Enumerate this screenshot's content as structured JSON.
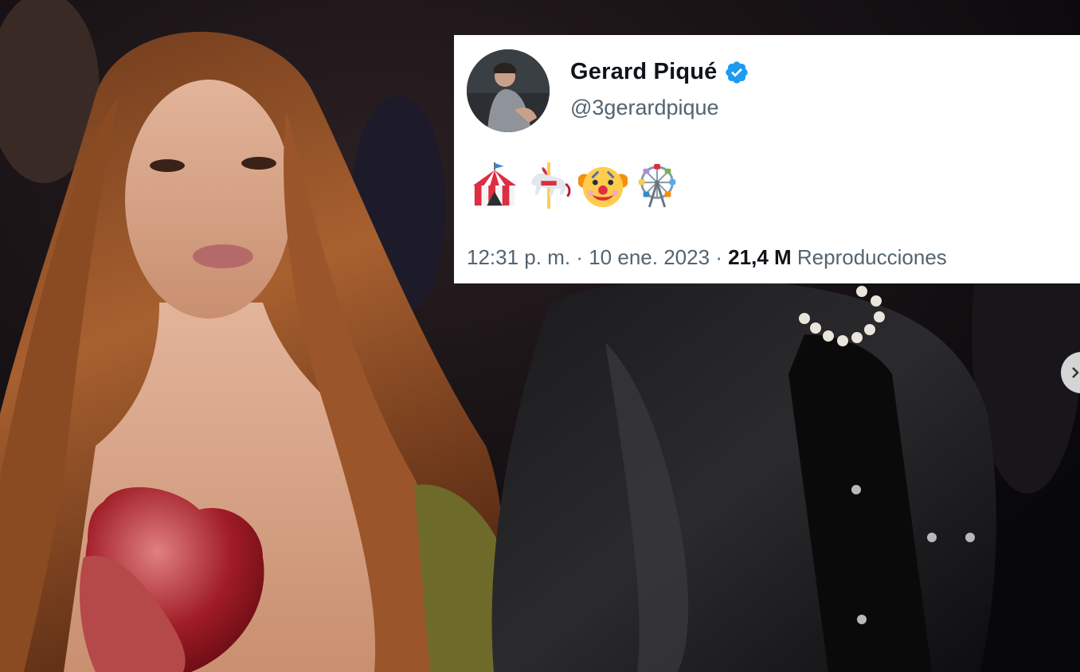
{
  "tweet": {
    "display_name": "Gerard Piqué",
    "handle": "@3gerardpique",
    "verified": true,
    "emojis": [
      "circus-tent",
      "carousel-horse",
      "clown-face",
      "ferris-wheel"
    ],
    "time": "12:31 p. m.",
    "separator": "·",
    "date": "10 ene. 2023",
    "views_count": "21,4 M",
    "views_label": "Reproducciones"
  },
  "colors": {
    "verified_blue": "#1d9bf0",
    "secondary_text": "#536471",
    "primary_text": "#0f1419",
    "card_bg": "#ffffff"
  }
}
